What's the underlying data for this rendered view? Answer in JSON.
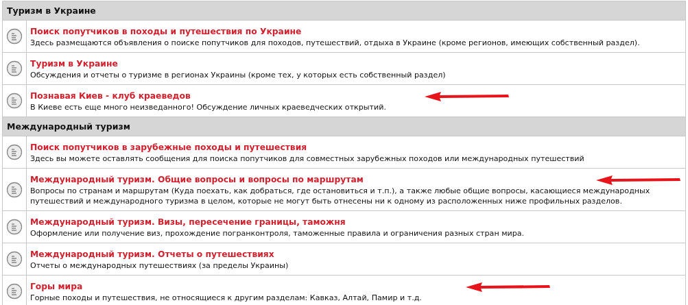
{
  "categories": [
    {
      "title": "Туризм в Украине",
      "forums": [
        {
          "title": "Поиск попутчиков в походы и путешествия по Украине",
          "description": "Здесь размещаются объявления о поиске попутчиков для походов, путешествий, отдыха в Украине (кроме регионов, имеющих собственный раздел).",
          "arrow": false
        },
        {
          "title": "Туризм в Украине",
          "description": "Обсуждения и отчеты о туризме в регионах Украины (кроме тех, у которых есть собственный раздел)",
          "arrow": false
        },
        {
          "title": "Познавая Киев - клуб краеведов",
          "description": "В Киеве есть еще много неизведанного! Обсуждение личных краеведческих открытий.",
          "arrow": true
        }
      ]
    },
    {
      "title": "Международный туризм",
      "forums": [
        {
          "title": "Поиск попутчиков в зарубежные походы и путешествия",
          "description": "Здесь вы можете оставлять сообщения для поиска попутчиков для совместных зарубежных походов или международных путешествий",
          "arrow": false
        },
        {
          "title": "Международный туризм. Общие вопросы и вопросы по маршрутам",
          "description": "Вопросы по странам и маршрутам (Куда поехать, как добраться, где остановиться и т.п.), а также любые общие вопросы, касающиеся международных путешествий и международного туризма в целом, которые не могут быть отнесены ни к одному из расположенных ниже профильных разделов.",
          "arrow": true
        },
        {
          "title": "Международный туризм. Визы, пересечение границы, таможня",
          "description": "Оформление или получение виз, прохождение погранконтроля, таможенные правила и ограничения разных стран мира.",
          "arrow": false
        },
        {
          "title": "Международный туризм. Отчеты о путешествиях",
          "description": "Отчеты о международных путешествиях (за пределы Украины)",
          "arrow": false
        },
        {
          "title": "Горы мира",
          "description": "Горные походы и путешествия, не относящиеся к другим разделам: Кавказ, Алтай, Памир и т.д.",
          "arrow": true
        }
      ]
    }
  ]
}
